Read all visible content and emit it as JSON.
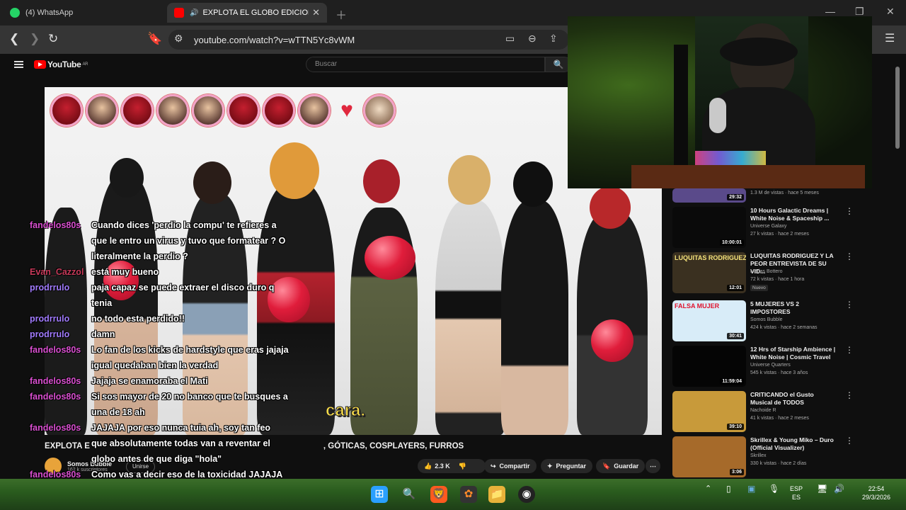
{
  "browser": {
    "tabs": [
      {
        "label": "(4) WhatsApp",
        "active": false,
        "icon": "whatsapp-icon"
      },
      {
        "label": "EXPLOTA EL GLOBO EDICION",
        "active": true,
        "icon": "youtube-icon"
      }
    ],
    "url": "youtube.com/watch?v=wTTN5Yc8vWM"
  },
  "youtube": {
    "logo": "YouTube",
    "region": "AR",
    "search_placeholder": "Buscar"
  },
  "video": {
    "caption": "cara.",
    "title": "EXPLOTA EL GLOBO EDICION ... ALTERNATIVAS, GÓTICAS, COSPLAYERS, FURROS",
    "title_visible": "EXPLOTA E",
    "title_tail": ", GÓTICAS, COSPLAYERS, FURROS",
    "channel": "Somos Bubble",
    "subs": "162 k suscriptores",
    "join": "Unirse",
    "likes": "2.3 K",
    "share": "Compartir",
    "ask": "Preguntar",
    "save": "Guardar"
  },
  "chat": [
    {
      "user": "fandelos80s",
      "user_color": "#d94fd0",
      "lines": [
        "Cuando dices 'perdio la compu' te refieres a",
        "que le entro un virus y tuvo que formatear ? O",
        "literalmente la perdio ?"
      ]
    },
    {
      "user": "Evan_Cazzol",
      "user_color": "#c83a5a",
      "lines": [
        "está muy bueno"
      ]
    },
    {
      "user": "prodrrulo",
      "user_color": "#a27cff",
      "lines": [
        "paja capaz se puede extraer el disco duro q",
        "tenia"
      ]
    },
    {
      "user": "prodrrulo",
      "user_color": "#a27cff",
      "lines": [
        "no todo esta perdido!!"
      ]
    },
    {
      "user": "prodrrulo",
      "user_color": "#a27cff",
      "lines": [
        "damn"
      ]
    },
    {
      "user": "fandelos80s",
      "user_color": "#d94fd0",
      "lines": [
        "Lo fan de los kicks de hardstyle que eras jajaja",
        "igual quedaban bien la verdad"
      ]
    },
    {
      "user": "fandelos80s",
      "user_color": "#d94fd0",
      "lines": [
        "Jajaja se enamoraba el Mati"
      ]
    },
    {
      "user": "fandelos80s",
      "user_color": "#d94fd0",
      "lines": [
        "Si sos mayor de 20 no banco que te busques a",
        "una de 18 ah"
      ]
    },
    {
      "user": "fandelos80s",
      "user_color": "#d94fd0",
      "lines": [
        "JAJAJA por eso nunca tuia ah, soy tan feo",
        "que absolutamente todas van a reventar el",
        "globo antes de que diga \"hola\""
      ]
    },
    {
      "user": "fandelos80s",
      "user_color": "#d94fd0",
      "lines": [
        "Como vas a decir eso de la toxicidad JAJAJA"
      ]
    }
  ],
  "sidebar": [
    {
      "title": "",
      "channel": "",
      "meta": "1.3 M de vistas · hace 5 meses",
      "duration": "29:32",
      "color": "#5a4a8a"
    },
    {
      "title": "10 Hours Galactic Dreams | White Noise & Spaceship ...",
      "channel": "Universe Galaxy",
      "meta": "27 k vistas · hace 2 meses",
      "duration": "10:00:01",
      "color": "#0a0a0a"
    },
    {
      "title": "LUQUITAS RODRIGUEZ Y LA PEOR ENTREVISTA DE SU VID...",
      "channel": "Matías Bottero",
      "meta": "72 k vistas · hace 1 hora",
      "badge": "Nuevo",
      "duration": "12:01",
      "color": "#3a3020",
      "overlay": "LUQUITAS RODRIGUEZ"
    },
    {
      "title": "5 MUJERES VS 2 IMPOSTORES",
      "channel": "Somos Bubble",
      "meta": "424 k vistas · hace 2 semanas",
      "duration": "30:41",
      "color": "#d8ecf8",
      "overlay": "FALSA MUJER"
    },
    {
      "title": "12 Hrs of Starship Ambience | White Noise | Cosmic Travel",
      "channel": "Universe Quarters",
      "meta": "545 k vistas · hace 3 años",
      "duration": "11:59:04",
      "color": "#050505"
    },
    {
      "title": "CRITICANDO el Gusto Musical de TODOS",
      "channel": "Nachoide R",
      "meta": "41 k vistas · hace 2 meses",
      "duration": "39:10",
      "color": "#c89a3a"
    },
    {
      "title": "Skrillex & Young Miko – Duro (Official Visualizer)",
      "channel": "Skrillex",
      "meta": "330 k vistas · hace 2 días",
      "duration": "3:06",
      "color": "#a66a2a"
    }
  ],
  "taskbar": {
    "lang_top": "ESP",
    "lang_bottom": "ES",
    "time": "22:54",
    "date": "29/3/2026"
  }
}
